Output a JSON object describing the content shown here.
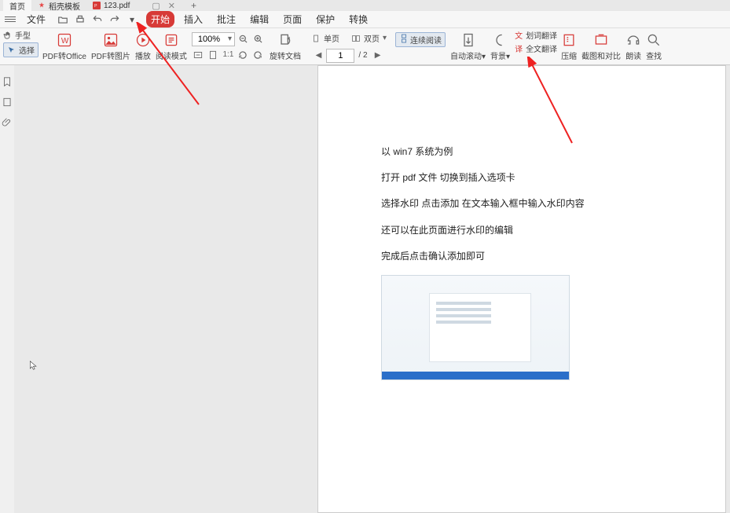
{
  "tabs": {
    "home": "首页",
    "template": "稻壳模板",
    "current": "123.pdf"
  },
  "menu": {
    "file": "文件",
    "start": "开始",
    "insert": "插入",
    "annotate": "批注",
    "edit": "编辑",
    "page": "页面",
    "protect": "保护",
    "convert": "转换"
  },
  "leftPanel": {
    "hand": "手型",
    "select": "选择"
  },
  "toolbar": {
    "pdf2office": "PDF转Office",
    "pdf2pic": "PDF转图片",
    "play": "播放",
    "readmode": "阅读模式",
    "zoom_value": "100%",
    "rotate": "旋转文档",
    "page_current": "1",
    "page_total": "/ 2",
    "single": "单页",
    "double": "双页",
    "continuous": "连续阅读",
    "autoscroll": "自动滚动",
    "background": "背景",
    "scratchTrans": "划词翻译",
    "fullTrans": "全文翻译",
    "compress": "压缩",
    "screenshot": "截图和对比",
    "read": "朗读",
    "find": "查找"
  },
  "doc": {
    "p1": "以 win7  系统为例",
    "p2": "打开 pdf 文件    切换到插入选项卡",
    "p3": "选择水印     点击添加    在文本输入框中输入水印内容",
    "p4": "还可以在此页面进行水印的编辑",
    "p5": "完成后点击确认添加即可"
  }
}
